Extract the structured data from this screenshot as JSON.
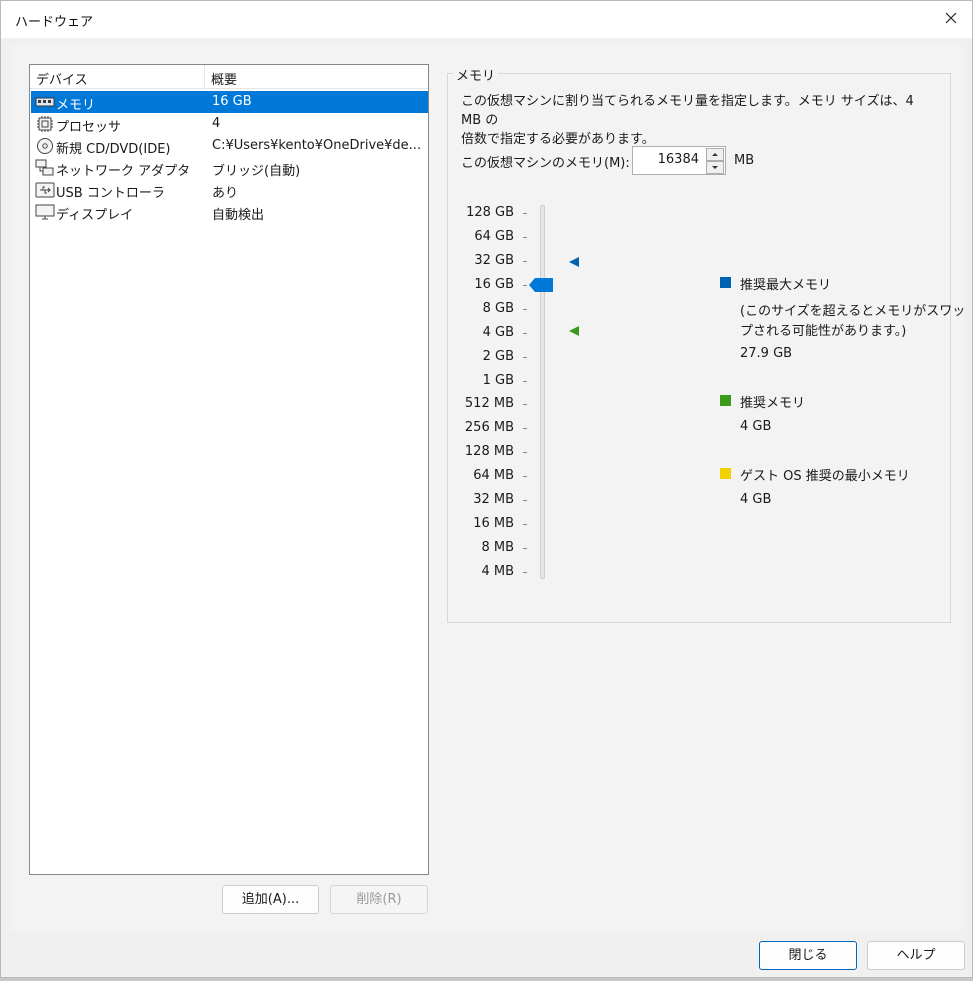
{
  "window": {
    "title": "ハードウェア"
  },
  "device_list": {
    "columns": [
      "デバイス",
      "概要"
    ],
    "rows": [
      {
        "icon": "memory-icon",
        "name": "メモリ",
        "summary": "16 GB",
        "selected": true
      },
      {
        "icon": "processor-icon",
        "name": "プロセッサ",
        "summary": "4",
        "selected": false
      },
      {
        "icon": "cd-dvd-icon",
        "name": "新規 CD/DVD(IDE)",
        "summary": "C:¥Users¥kento¥OneDrive¥de...",
        "selected": false
      },
      {
        "icon": "network-adapter-icon",
        "name": "ネットワーク アダプタ",
        "summary": "ブリッジ(自動)",
        "selected": false
      },
      {
        "icon": "usb-icon",
        "name": "USB コントローラ",
        "summary": "あり",
        "selected": false
      },
      {
        "icon": "display-icon",
        "name": "ディスプレイ",
        "summary": "自動検出",
        "selected": false
      }
    ]
  },
  "buttons": {
    "add": "追加(A)...",
    "remove": "削除(R)",
    "close": "閉じる",
    "help": "ヘルプ"
  },
  "memory": {
    "group_label": "メモリ",
    "description_line1": "この仮想マシンに割り当てられるメモリ量を指定します。メモリ サイズは、4 MB の",
    "description_line2": "倍数で指定する必要があります。",
    "field_label": "この仮想マシンのメモリ(M):",
    "value": "16384",
    "unit": "MB",
    "scale_labels": [
      "128 GB",
      "64 GB",
      "32 GB",
      "16 GB",
      "8 GB",
      "4 GB",
      "2 GB",
      "1 GB",
      "512 MB",
      "256 MB",
      "128 MB",
      "64 MB",
      "32 MB",
      "16 MB",
      "8 MB",
      "4 MB"
    ],
    "slider_value": "16 GB"
  },
  "legend": {
    "max": {
      "title": "推奨最大メモリ",
      "note_line1": "(このサイズを超えるとメモリがスワッ",
      "note_line2": "プされる可能性があります。)",
      "value": "27.9 GB",
      "color": "#0063b1"
    },
    "recommended": {
      "title": "推奨メモリ",
      "value": "4 GB",
      "color": "#3a9a1a"
    },
    "guest_min": {
      "title": "ゲスト OS 推奨の最小メモリ",
      "value": "4 GB",
      "color": "#f2d100"
    }
  }
}
